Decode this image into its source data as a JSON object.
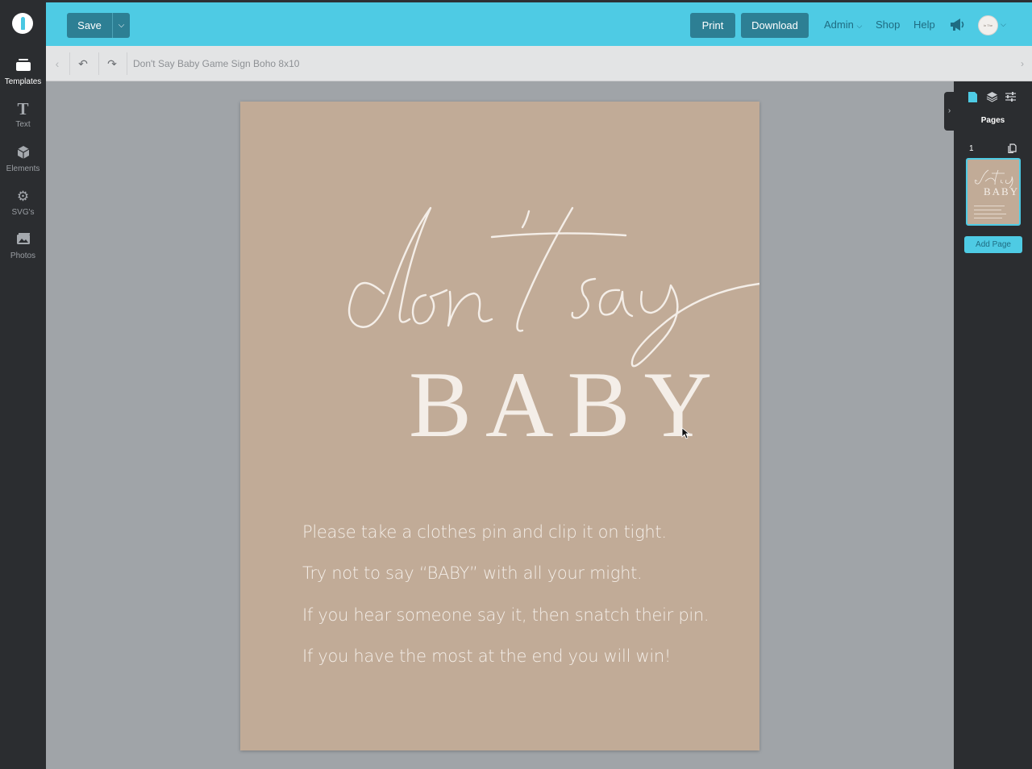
{
  "app": {
    "accent_color": "#4ecbe4",
    "button_color": "#2d7f94",
    "sheet_color": "#c1ab97"
  },
  "sidebar": {
    "items": [
      {
        "label": "Templates",
        "icon": "templates-icon"
      },
      {
        "label": "Text",
        "icon": "text-icon"
      },
      {
        "label": "Elements",
        "icon": "elements-icon"
      },
      {
        "label": "SVG's",
        "icon": "svgs-icon"
      },
      {
        "label": "Photos",
        "icon": "photos-icon"
      }
    ]
  },
  "topbar": {
    "save_label": "Save",
    "print_label": "Print",
    "download_label": "Download",
    "admin_label": "Admin",
    "shop_label": "Shop",
    "help_label": "Help",
    "avatar_text": "In The Groove"
  },
  "subbar": {
    "document_title": "Don't Say Baby Game Sign Boho 8x10"
  },
  "canvas": {
    "script_title": "don't say",
    "big_word": "BABY",
    "rules": [
      "Please take a clothes pin and clip it on tight.",
      "Try not to say “BABY” with all your might.",
      "If you hear someone say it, then snatch their pin.",
      "If you have the most at the end you will  win!"
    ]
  },
  "right_panel": {
    "title": "Pages",
    "page_number": "1",
    "thumb_big_word": "BABY",
    "add_page_label": "Add Page"
  }
}
